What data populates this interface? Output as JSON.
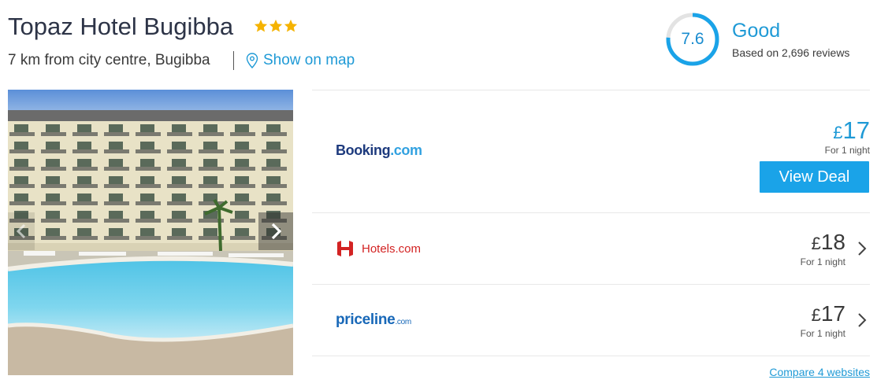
{
  "hotel": {
    "name": "Topaz Hotel Bugibba",
    "star_count": 3,
    "location": "7 km from city centre, Bugibba",
    "map_link": "Show on map"
  },
  "rating": {
    "score": "7.6",
    "fraction": 0.76,
    "word": "Good",
    "reviews": "Based on 2,696 reviews"
  },
  "deals": [
    {
      "site": "Booking.com",
      "logo_main": "Booking",
      "logo_tld": ".com",
      "currency": "£",
      "price": "17",
      "per_night": "For 1 night",
      "button": "View Deal"
    },
    {
      "site": "Hotels.com",
      "logo_main": "Hotels.com",
      "currency": "£",
      "price": "18",
      "per_night": "For 1 night"
    },
    {
      "site": "priceline.com",
      "logo_main": "priceline",
      "logo_tld": ".com",
      "currency": "£",
      "price": "17",
      "per_night": "For 1 night"
    }
  ],
  "compare_link": "Compare 4 websites",
  "colors": {
    "accent": "#1f9ad6",
    "button": "#1aa3e8",
    "star": "#f5b301",
    "booking_navy": "#1d3a7d",
    "hotels_red": "#d32323",
    "priceline_blue": "#1868b8"
  },
  "icons": {
    "stars": "star-icon",
    "map": "map-pin-icon",
    "gallery_prev": "chevron-left-icon",
    "gallery_next": "chevron-right-icon",
    "deal_arrow": "chevron-right-icon"
  }
}
